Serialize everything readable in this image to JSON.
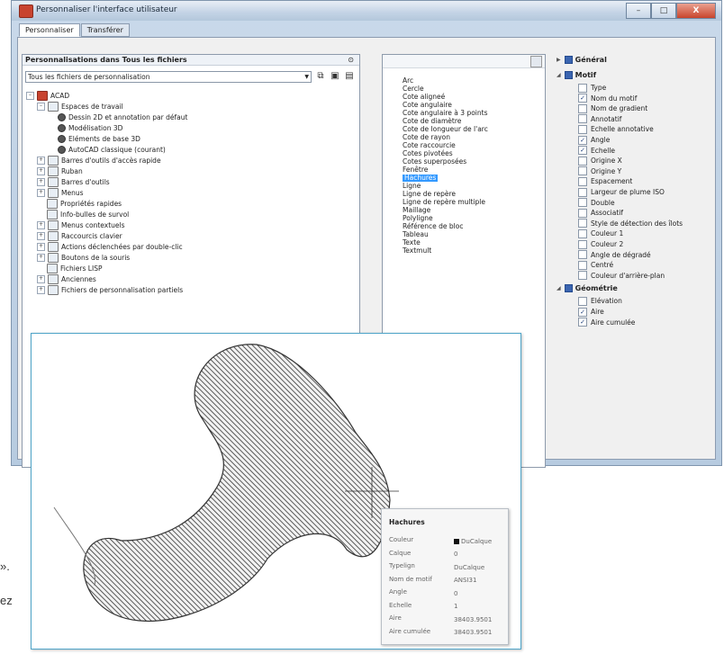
{
  "window": {
    "title": "Personnaliser l'interface utilisateur",
    "tabs": [
      "Personnaliser",
      "Transférer"
    ],
    "buttons": {
      "minimize": "–",
      "maximize": "□",
      "close": "X"
    }
  },
  "left_panel": {
    "header": "Personnalisations dans Tous les fichiers",
    "pin": "⊙",
    "combo_value": "Tous les fichiers de personnalisation",
    "tree": [
      {
        "label": "ACAD",
        "icon": "acad-icon",
        "level": 0,
        "exp": "–"
      },
      {
        "label": "Espaces de travail",
        "icon": "workspace-icon",
        "level": 1,
        "exp": "–"
      },
      {
        "label": "Dessin 2D et annotation par défaut",
        "icon": "gear-icon",
        "level": 2
      },
      {
        "label": "Modélisation 3D",
        "icon": "gear-icon",
        "level": 2
      },
      {
        "label": "Eléments de base 3D",
        "icon": "gear-icon",
        "level": 2
      },
      {
        "label": "AutoCAD classique (courant)",
        "icon": "gear-icon",
        "level": 2
      },
      {
        "label": "Barres d'outils d'accès rapide",
        "icon": "toolbar-icon",
        "level": 1,
        "exp": "+"
      },
      {
        "label": "Ruban",
        "icon": "ribbon-icon",
        "level": 1,
        "exp": "+"
      },
      {
        "label": "Barres d'outils",
        "icon": "toolbar-icon",
        "level": 1,
        "exp": "+"
      },
      {
        "label": "Menus",
        "icon": "menu-icon",
        "level": 1,
        "exp": "+"
      },
      {
        "label": "Propriétés rapides",
        "icon": "properties-icon",
        "level": 1
      },
      {
        "label": "Info-bulles de survol",
        "icon": "tooltip-icon",
        "level": 1
      },
      {
        "label": "Menus contextuels",
        "icon": "menu-icon",
        "level": 1,
        "exp": "+"
      },
      {
        "label": "Raccourcis clavier",
        "icon": "keyboard-icon",
        "level": 1,
        "exp": "+"
      },
      {
        "label": "Actions déclenchées par double-clic",
        "icon": "mouse-icon",
        "level": 1,
        "exp": "+"
      },
      {
        "label": "Boutons de la souris",
        "icon": "mouse-icon",
        "level": 1,
        "exp": "+"
      },
      {
        "label": "Fichiers LISP",
        "icon": "lisp-icon",
        "level": 1
      },
      {
        "label": "Anciennes",
        "icon": "legacy-icon",
        "level": 1,
        "exp": "+"
      },
      {
        "label": "Fichiers de personnalisation partiels",
        "icon": "partial-file-icon",
        "level": 1,
        "exp": "+"
      }
    ]
  },
  "object_list": {
    "items": [
      "Arc",
      "Cercle",
      "Cote aligneé",
      "Cote angulaire",
      "Cote angulaire à 3 points",
      "Cote de diamètre",
      "Cote de longueur de l'arc",
      "Cote de rayon",
      "Cote raccourcie",
      "Cotes pivotées",
      "Cotes superposées",
      "Fenêtre",
      "Hachures",
      "Ligne",
      "Ligne de repère",
      "Ligne de repère multiple",
      "Maillage",
      "Polyligne",
      "Référence de bloc",
      "Tableau",
      "Texte",
      "Textmult"
    ],
    "selected": "Hachures"
  },
  "properties_tree": {
    "groups": [
      {
        "name": "Général",
        "expanded": false,
        "items": []
      },
      {
        "name": "Motif",
        "expanded": true,
        "items": [
          {
            "label": "Type",
            "checked": false
          },
          {
            "label": "Nom du motif",
            "checked": true
          },
          {
            "label": "Nom de gradient",
            "checked": false
          },
          {
            "label": "Annotatif",
            "checked": false
          },
          {
            "label": "Echelle annotative",
            "checked": false
          },
          {
            "label": "Angle",
            "checked": true
          },
          {
            "label": "Echelle",
            "checked": true
          },
          {
            "label": "Origine X",
            "checked": false
          },
          {
            "label": "Origine Y",
            "checked": false
          },
          {
            "label": "Espacement",
            "checked": false
          },
          {
            "label": "Largeur de plume ISO",
            "checked": false
          },
          {
            "label": "Double",
            "checked": false
          },
          {
            "label": "Associatif",
            "checked": false
          },
          {
            "label": "Style de détection des îlots",
            "checked": false
          },
          {
            "label": "Couleur 1",
            "checked": false
          },
          {
            "label": "Couleur 2",
            "checked": false
          },
          {
            "label": "Angle de dégradé",
            "checked": false
          },
          {
            "label": "Centré",
            "checked": false
          },
          {
            "label": "Couleur d'arrière-plan",
            "checked": false
          }
        ]
      },
      {
        "name": "Géométrie",
        "expanded": true,
        "items": [
          {
            "label": "Elévation",
            "checked": false
          },
          {
            "label": "Aire",
            "checked": true
          },
          {
            "label": "Aire cumulée",
            "checked": true
          }
        ]
      }
    ]
  },
  "quick_properties": {
    "title": "Hachures",
    "rows": [
      {
        "key": "Couleur",
        "value": "DuCalque",
        "swatch": true
      },
      {
        "key": "Calque",
        "value": "0"
      },
      {
        "key": "Typelign",
        "value": "DuCalque"
      },
      {
        "key": "Nom de motif",
        "value": "ANSI31"
      },
      {
        "key": "Angle",
        "value": "0"
      },
      {
        "key": "Echelle",
        "value": "1"
      },
      {
        "key": "Aire",
        "value": "38403.9501"
      },
      {
        "key": "Aire cumulée",
        "value": "38403.9501"
      }
    ]
  },
  "page_text": {
    "line1": "».",
    "line2": "ez"
  }
}
